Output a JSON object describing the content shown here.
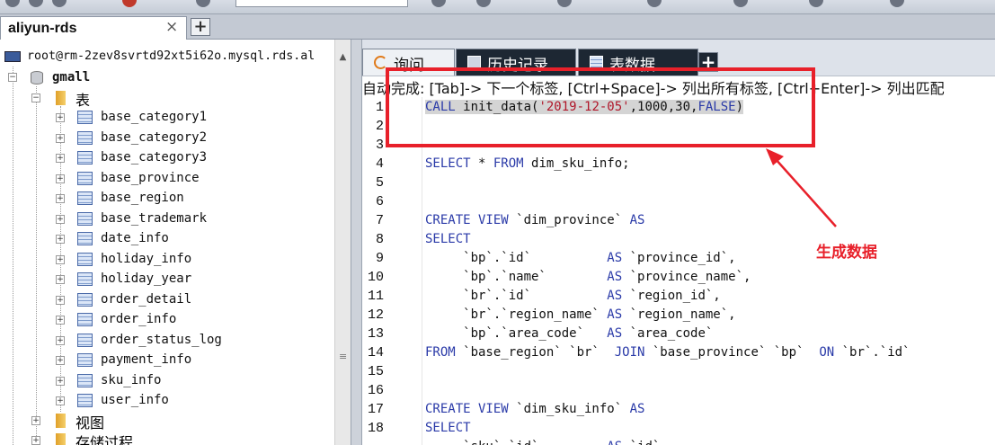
{
  "window": {
    "connection_tab": "aliyun-rds",
    "close_glyph": "×",
    "add_glyph": "+"
  },
  "tree": {
    "connection": "root@rm-2zev8svrtd92xt5i62o.mysql.rds.al",
    "database": "gmall",
    "tables_folder": "表",
    "tables": [
      "base_category1",
      "base_category2",
      "base_category3",
      "base_province",
      "base_region",
      "base_trademark",
      "date_info",
      "holiday_info",
      "holiday_year",
      "order_detail",
      "order_info",
      "order_status_log",
      "payment_info",
      "sku_info",
      "user_info"
    ],
    "views_folder": "视图",
    "procs_folder": "存储过程"
  },
  "editor": {
    "tabs": [
      "询问",
      "历史记录",
      "表数据"
    ],
    "add_tab": "+",
    "hint": "自动完成: [Tab]-> 下一个标签, [Ctrl+Space]-> 列出所有标签, [Ctrl+Enter]-> 列出匹配",
    "line_numbers": [
      "1",
      "2",
      "3",
      "4",
      "5",
      "6",
      "7",
      "8",
      "9",
      "10",
      "11",
      "12",
      "13",
      "14",
      "15",
      "16",
      "17",
      "18"
    ]
  },
  "annotation": {
    "label": "生成数据",
    "color": "#e8202a"
  },
  "colors": {
    "keyword": "#2a3aa8",
    "string": "#b0172a",
    "highlight": "#d4d4d4",
    "tab_dark": "#1d2733"
  }
}
